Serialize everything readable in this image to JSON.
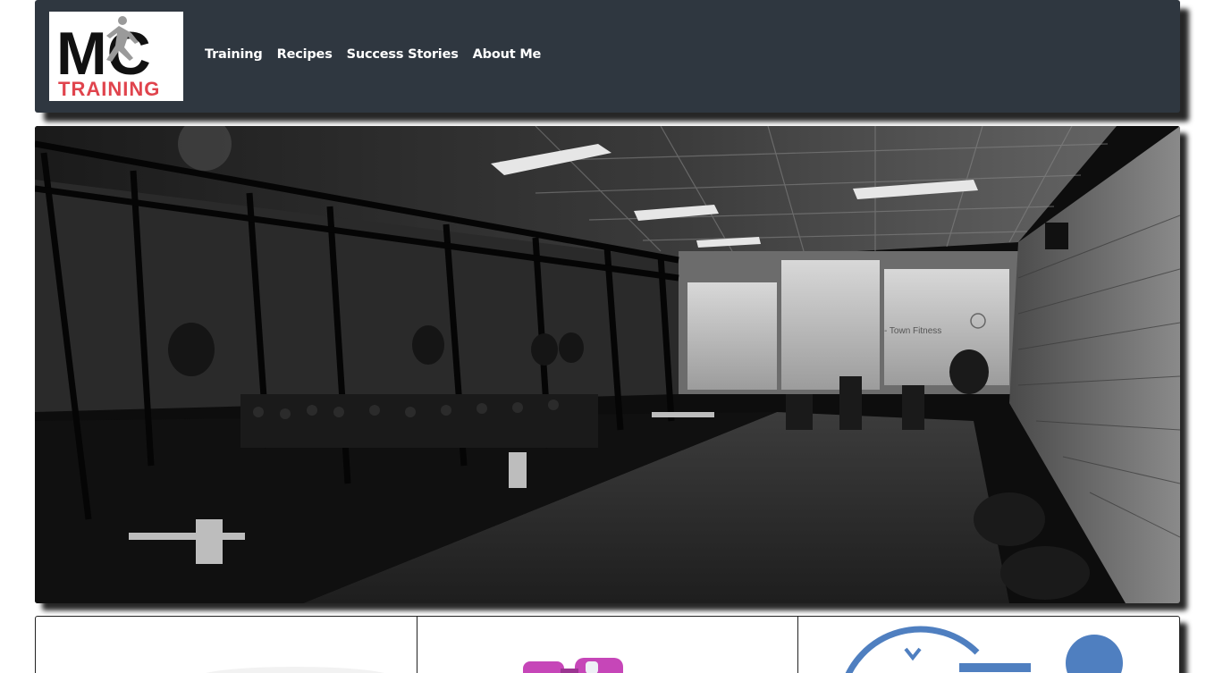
{
  "logo": {
    "initials": "MC",
    "subtitle": "TRAINING",
    "colors": {
      "initials": "#111111",
      "subtitle": "#e0444d",
      "runner": "#9a9a9a"
    }
  },
  "nav": {
    "items": [
      {
        "label": "Training"
      },
      {
        "label": "Recipes"
      },
      {
        "label": "Success Stories"
      },
      {
        "label": "About Me"
      }
    ]
  },
  "hero": {
    "sign_text": "- Town Fitness"
  },
  "colors": {
    "header_bg": "#2f3740",
    "nav_text": "#ffffff",
    "dumbbell_accent": "#c646b8",
    "clock_accent": "#4f7fc0"
  },
  "cards": [
    {
      "icon": "fitness-photo-icon"
    },
    {
      "icon": "dumbbell-icon"
    },
    {
      "icon": "clock-icon"
    }
  ]
}
